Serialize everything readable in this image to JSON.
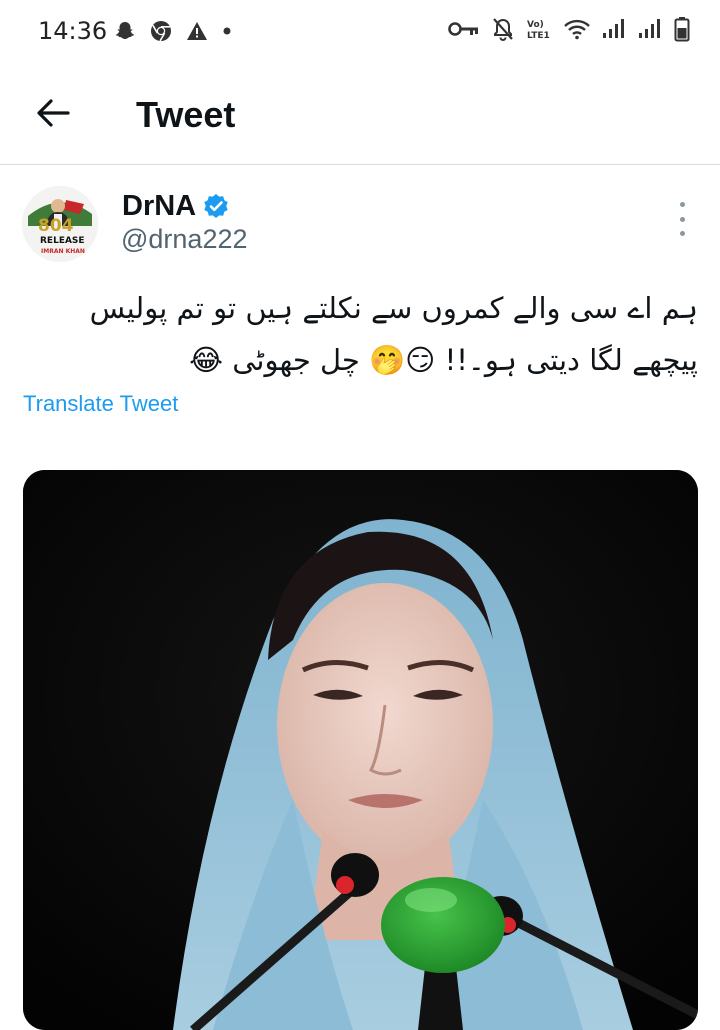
{
  "status_bar": {
    "time": "14:36",
    "left_icons": [
      "snapchat-icon",
      "chrome-icon",
      "warning-icon",
      "dot-icon"
    ],
    "right_icons": [
      "key-icon",
      "mute-icon",
      "volte-icon",
      "wifi-icon",
      "signal-icon",
      "signal-icon",
      "battery-icon"
    ],
    "volte_label": "Vo) LTE1"
  },
  "header": {
    "title": "Tweet",
    "back_icon": "arrow-left-icon"
  },
  "author": {
    "name": "DrNA",
    "handle": "@drna222",
    "verified": true,
    "avatar_text_1": "804",
    "avatar_text_2": "RELEASE",
    "avatar_text_3": "IMRAN KHAN"
  },
  "tweet": {
    "line1": "ہم اے سی والے کمروں سے نکلتے ہیں تو تم پولیس",
    "line2": "پیچھے لگا دیتی ہو۔!! 😏🤭 چل جھوٹی 😂",
    "translate_label": "Translate Tweet"
  },
  "media": {
    "type": "photo",
    "subject": "woman-at-podium"
  },
  "colors": {
    "link": "#1d9bf0",
    "verified": "#1d9bf0",
    "handle": "#536471"
  }
}
